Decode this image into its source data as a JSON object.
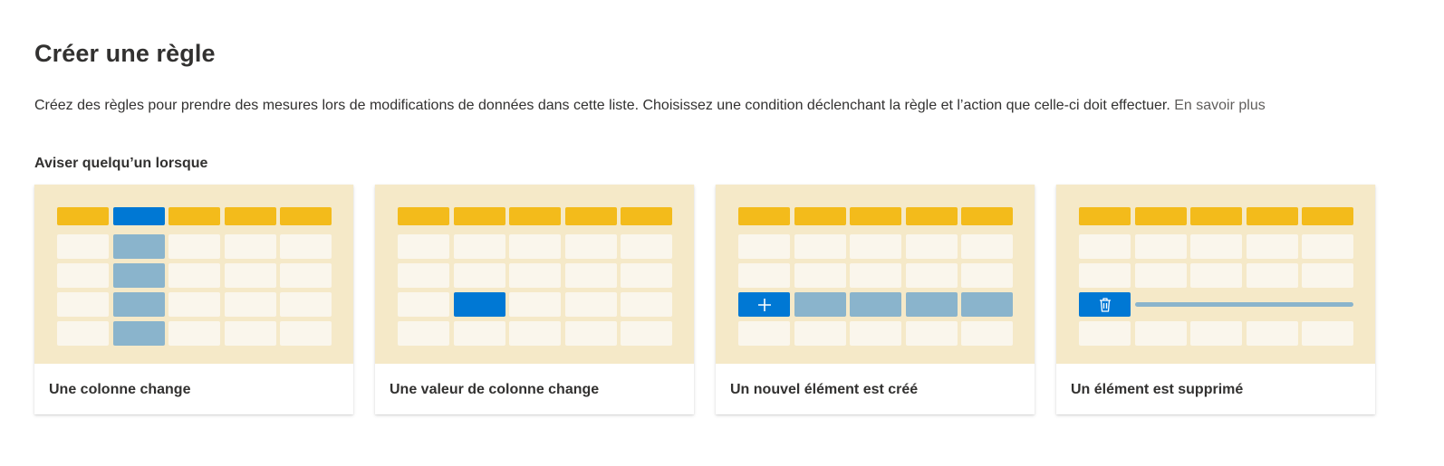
{
  "page": {
    "title": "Créer une règle",
    "description": "Créez des règles pour prendre des mesures lors de modifications de données dans cette liste. Choisissez une condition déclenchant la règle et l’action que celle-ci doit effectuer.",
    "learn_more": "En savoir plus",
    "section_title": "Aviser quelqu’un lorsque"
  },
  "cards": [
    {
      "label": "Une colonne change",
      "illustration": "column-highlight"
    },
    {
      "label": "Une valeur de colonne change",
      "illustration": "cell-highlight"
    },
    {
      "label": "Un nouvel élément est créé",
      "illustration": "row-added",
      "icon": "plus-icon"
    },
    {
      "label": "Un élément est supprimé",
      "illustration": "row-deleted",
      "icon": "trash-icon"
    }
  ],
  "colors": {
    "illustration_bg": "#f5e9c8",
    "header_cell": "#f3bb1b",
    "cell": "#faf6ec",
    "accent_blue": "#0078d4",
    "muted_blue": "#8ab4cc"
  }
}
